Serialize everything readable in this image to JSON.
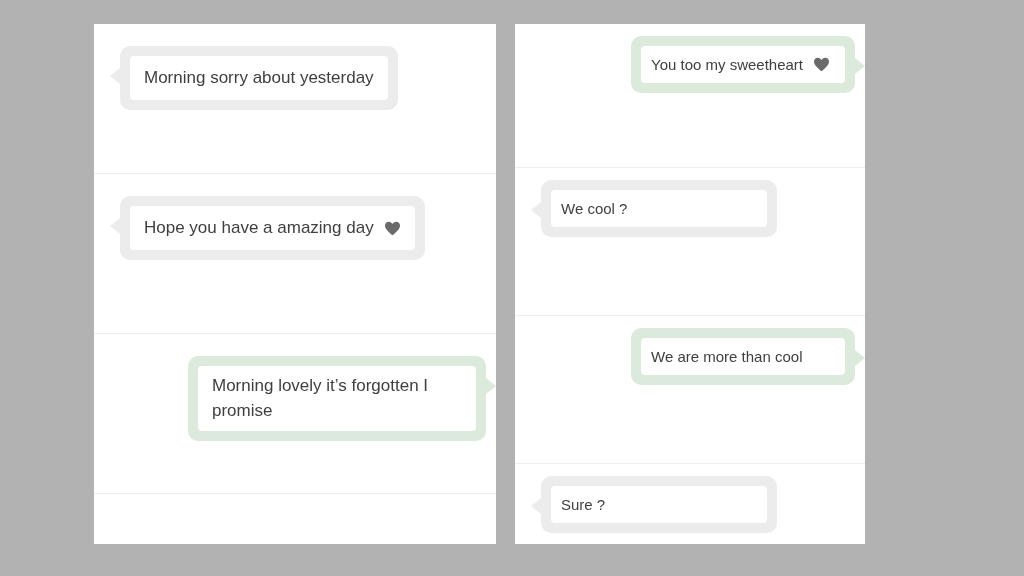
{
  "panels": [
    {
      "rows": [
        {
          "kind": "received",
          "text": "Morning sorry about yesterday",
          "heart": false
        },
        {
          "kind": "received",
          "text": "Hope you have a amazing day",
          "heart": true
        },
        {
          "kind": "sent",
          "text": "Morning lovely it’s forgotten I promise",
          "heart": false
        }
      ]
    },
    {
      "rows": [
        {
          "kind": "sent",
          "text": "You too my sweetheart",
          "heart": true
        },
        {
          "kind": "received",
          "text": "We cool ?",
          "heart": false
        },
        {
          "kind": "sent",
          "text": "We are more than cool",
          "heart": false
        },
        {
          "kind": "received",
          "text": "Sure ?",
          "heart": false
        }
      ]
    }
  ]
}
